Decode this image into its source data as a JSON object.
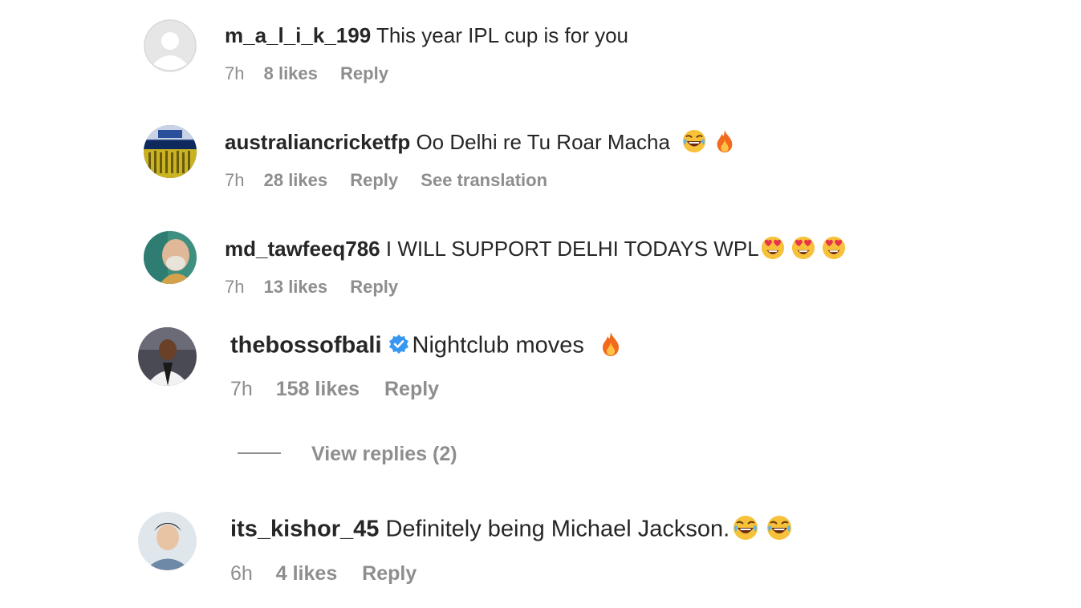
{
  "comments": [
    {
      "username": "m_a_l_i_k_199",
      "text": "This year IPL cup is for you",
      "time": "7h",
      "likes": "8 likes",
      "reply": "Reply"
    },
    {
      "username": "australiancricketfp",
      "text": "Oo Delhi re Tu Roar Macha",
      "emojis": [
        "laughing-emoji",
        "fire-emoji"
      ],
      "time": "7h",
      "likes": "28 likes",
      "reply": "Reply",
      "translate": "See translation"
    },
    {
      "username": "md_tawfeeq786",
      "text": "I WILL SUPPORT DELHI TODAYS WPL",
      "emojis": [
        "heart-eyes-emoji",
        "heart-eyes-emoji",
        "heart-eyes-emoji"
      ],
      "time": "7h",
      "likes": "13 likes",
      "reply": "Reply"
    },
    {
      "username": "thebossofbali",
      "verified": true,
      "text": "Nightclub moves",
      "emojis": [
        "fire-emoji"
      ],
      "time": "7h",
      "likes": "158 likes",
      "reply": "Reply",
      "view_replies": "View replies (2)"
    },
    {
      "username": "its_kishor_45",
      "text": "Definitely being Michael Jackson.",
      "emojis": [
        "laughing-emoji",
        "laughing-emoji"
      ],
      "time": "6h",
      "likes": "4 likes",
      "reply": "Reply"
    }
  ],
  "colors": {
    "text": "#262626",
    "secondary": "#8e8e8e",
    "verified": "#3897f0"
  }
}
